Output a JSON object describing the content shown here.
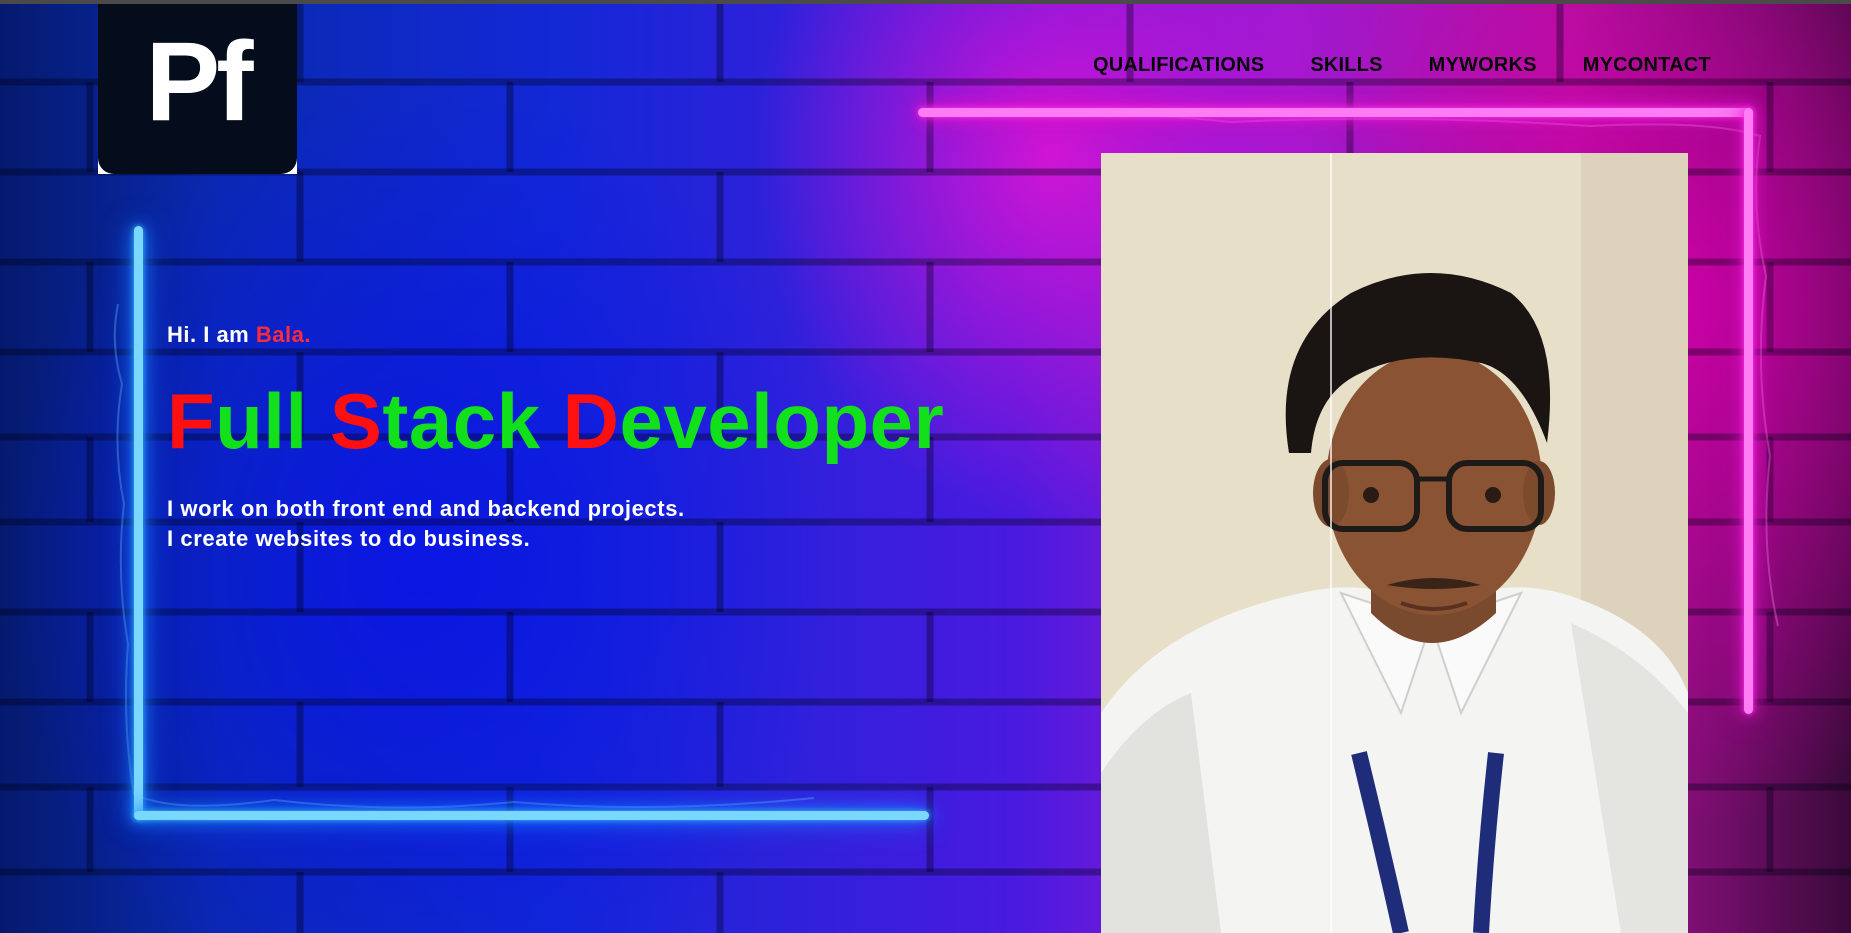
{
  "logo": {
    "text": "Pf"
  },
  "nav": {
    "items": [
      {
        "label": "QUALIFICATIONS"
      },
      {
        "label": "SKILLS"
      },
      {
        "label": "MYWORKS"
      },
      {
        "label": "MYCONTACT"
      }
    ]
  },
  "hero": {
    "intro_prefix": "Hi. I am ",
    "intro_name": "Bala.",
    "headline": [
      {
        "cap": "F",
        "rest": "ull "
      },
      {
        "cap": "S",
        "rest": "tack "
      },
      {
        "cap": "D",
        "rest": "eveloper"
      }
    ],
    "description_line1": "I work on both front end and backend projects.",
    "description_line2": "I create websites to do business."
  },
  "colors": {
    "accent_red": "#ff1010",
    "accent_green": "#12e01a",
    "neon_blue": "#7ad8ff",
    "neon_pink": "#ff7cf4"
  }
}
